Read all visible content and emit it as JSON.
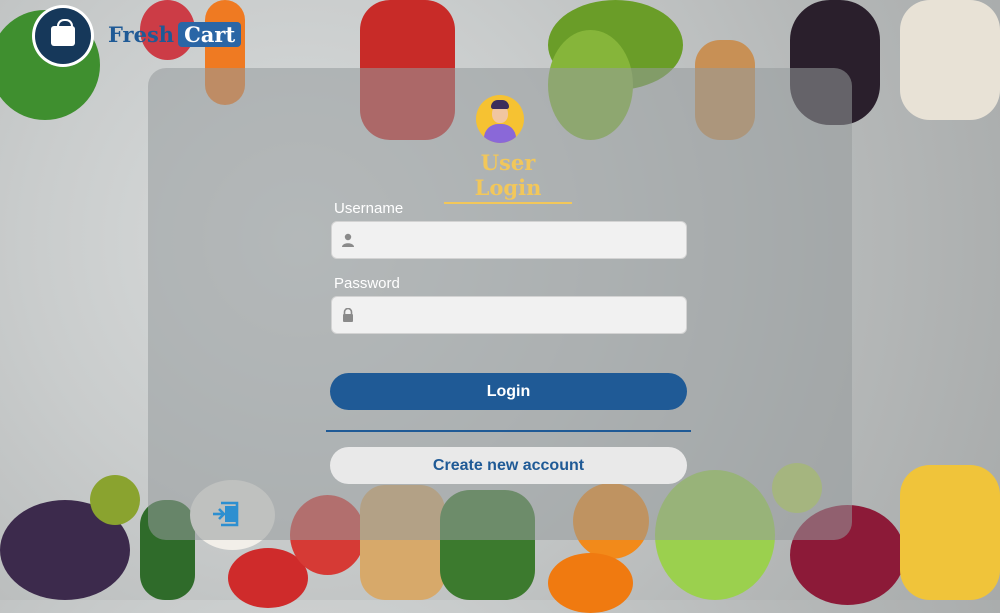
{
  "brand": {
    "name_part1": "Fresh",
    "name_part2": "Cart"
  },
  "login": {
    "title": "User Login",
    "username_label": "Username",
    "username_value": "",
    "password_label": "Password",
    "password_value": "",
    "login_button": "Login",
    "create_account_button": "Create new account"
  },
  "icons": {
    "logo": "fresh-cart-logo",
    "avatar": "user-avatar",
    "username": "user-icon",
    "password": "lock-icon",
    "exit": "exit-icon"
  },
  "colors": {
    "primary": "#1f5a96",
    "accent": "#f2c75a",
    "field_bg": "#f1f1f1"
  }
}
